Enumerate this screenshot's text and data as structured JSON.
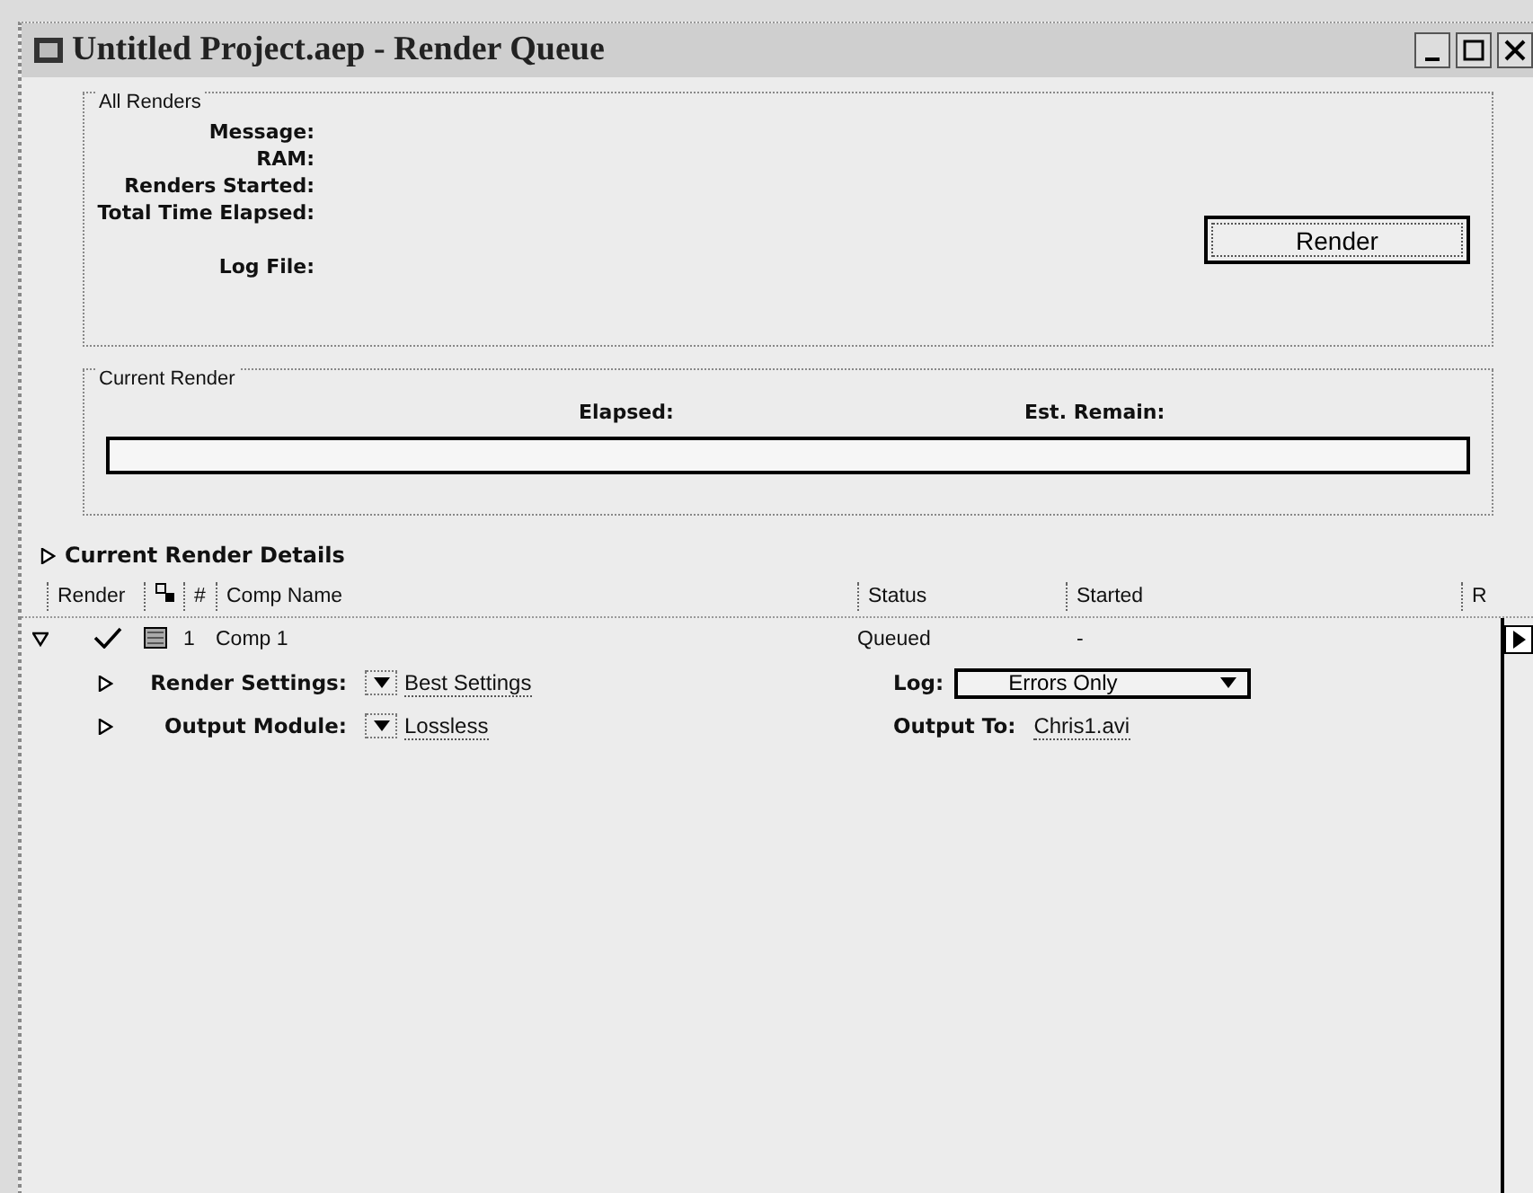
{
  "window": {
    "title": "Untitled Project.aep - Render Queue"
  },
  "all_renders": {
    "label": "All Renders",
    "fields": [
      {
        "label": "Message:"
      },
      {
        "label": "RAM:"
      },
      {
        "label": "Renders Started:"
      },
      {
        "label": "Total Time Elapsed:"
      },
      {
        "label": "Log File:",
        "gap": true
      }
    ],
    "render_button": "Render"
  },
  "current_render": {
    "label": "Current Render",
    "elapsed_label": "Elapsed:",
    "remain_label": "Est. Remain:"
  },
  "details": {
    "label": "Current Render Details",
    "expanded": false
  },
  "table": {
    "columns": [
      {
        "kind": "text",
        "label": "Render"
      },
      {
        "kind": "icon"
      },
      {
        "kind": "text",
        "label": "#"
      },
      {
        "kind": "text",
        "label": "Comp Name"
      },
      {
        "kind": "text",
        "label": "Status"
      },
      {
        "kind": "text",
        "label": "Started"
      },
      {
        "kind": "text",
        "label": "R"
      }
    ],
    "rows": [
      {
        "expanded": true,
        "render": true,
        "number": "1",
        "comp_name": "Comp 1",
        "status": "Queued",
        "started": "-",
        "render_settings": {
          "label": "Render Settings:",
          "value": "Best Settings",
          "expanded": false
        },
        "output_module": {
          "label": "Output Module:",
          "value": "Lossless",
          "expanded": false
        },
        "log": {
          "label": "Log:",
          "value": "Errors Only"
        },
        "output_to": {
          "label": "Output To:",
          "value": "Chris1.avi"
        }
      }
    ]
  }
}
